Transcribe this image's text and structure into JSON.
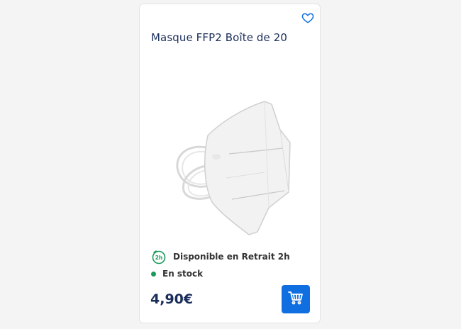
{
  "product": {
    "title": "Masque FFP2 Boîte de 20",
    "availability_label": "Disponible en Retrait 2h",
    "stock_label": "En stock",
    "price": "4,90€",
    "pickup_badge": "2h"
  },
  "colors": {
    "accent_blue": "#0f6fe0",
    "title_navy": "#1a2d5a",
    "stock_green": "#1a9a5c"
  },
  "icons": {
    "favorite": "heart-outline-icon",
    "pickup": "clock-2h-icon",
    "cart": "shopping-cart-icon"
  }
}
